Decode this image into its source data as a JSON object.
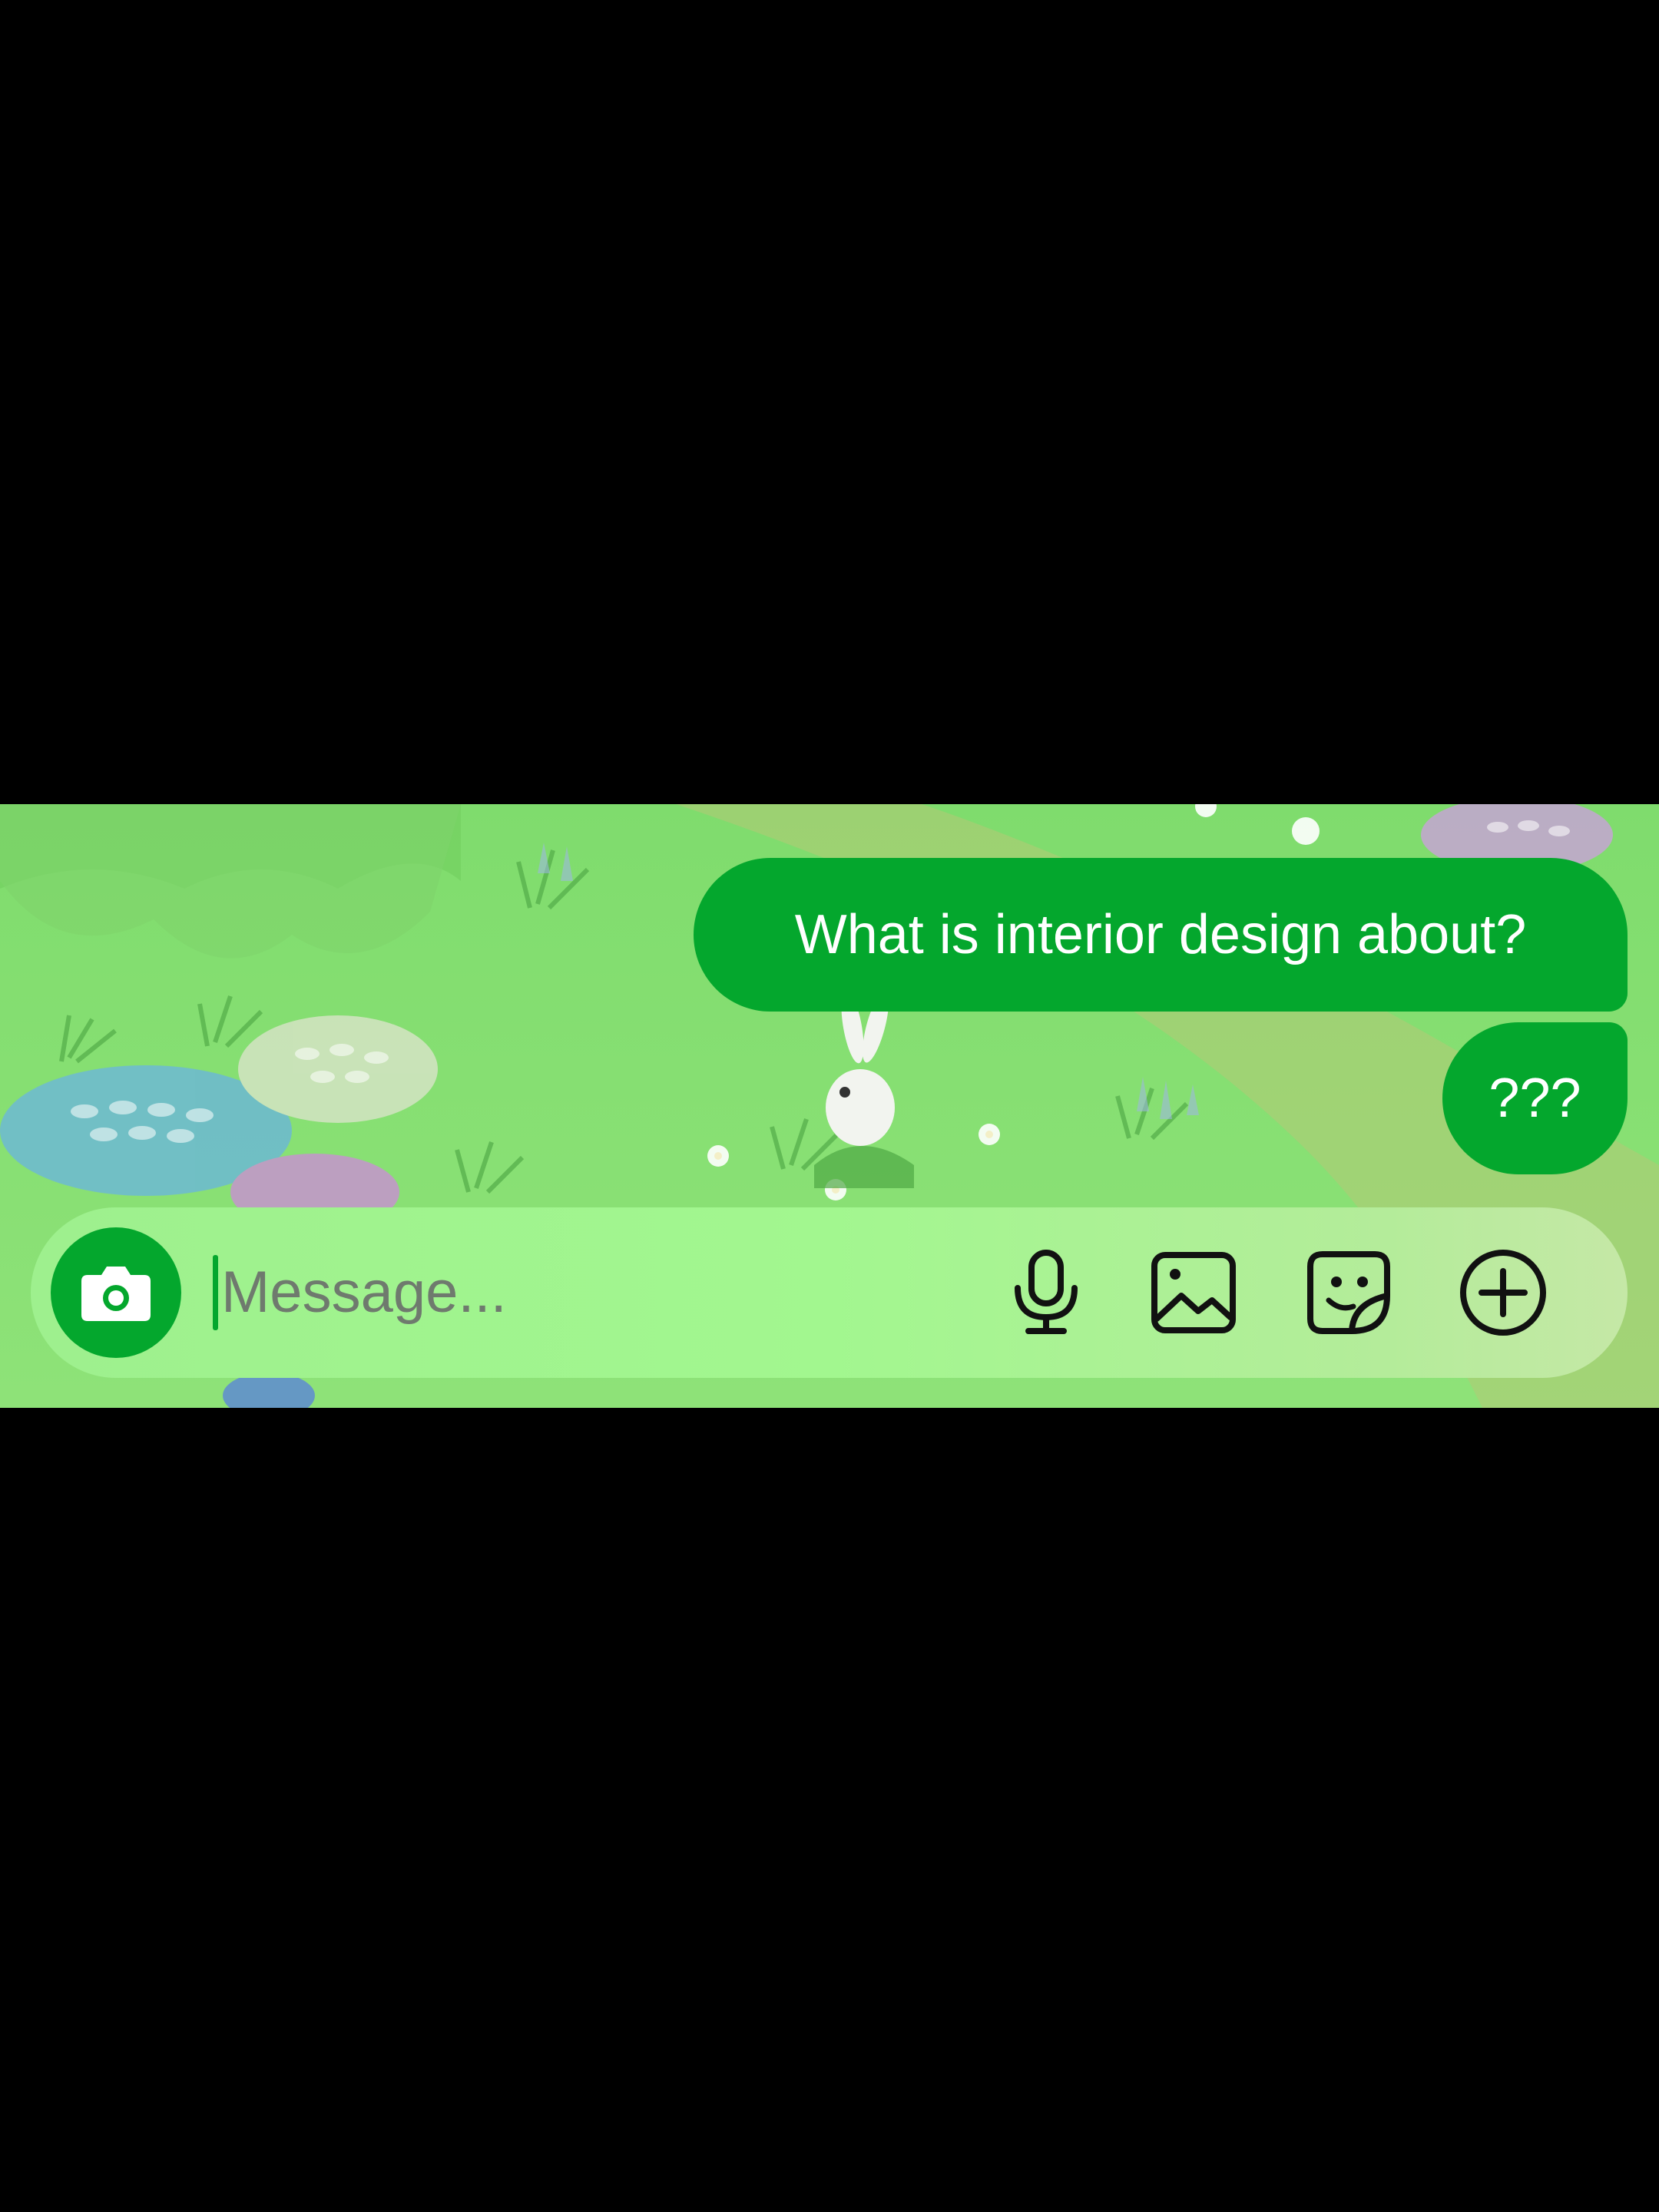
{
  "colors": {
    "accent": "#04a72d",
    "letterbox": "#000000",
    "wallpaper": "#86df72",
    "composer": "#a2f78f",
    "placeholder": "#6f7a6e",
    "icon": "#111111"
  },
  "wallpaper": {
    "theme": "meadow-with-bunny-and-flowers"
  },
  "messages": [
    {
      "direction": "outgoing",
      "text": "What is interior design about?"
    },
    {
      "direction": "outgoing",
      "text": "???"
    }
  ],
  "composer": {
    "placeholder": "Message...",
    "value": "",
    "icons": {
      "camera": "camera-icon",
      "mic": "microphone-icon",
      "gallery": "image-icon",
      "sticker": "sticker-icon",
      "more": "plus-circle-icon"
    }
  }
}
